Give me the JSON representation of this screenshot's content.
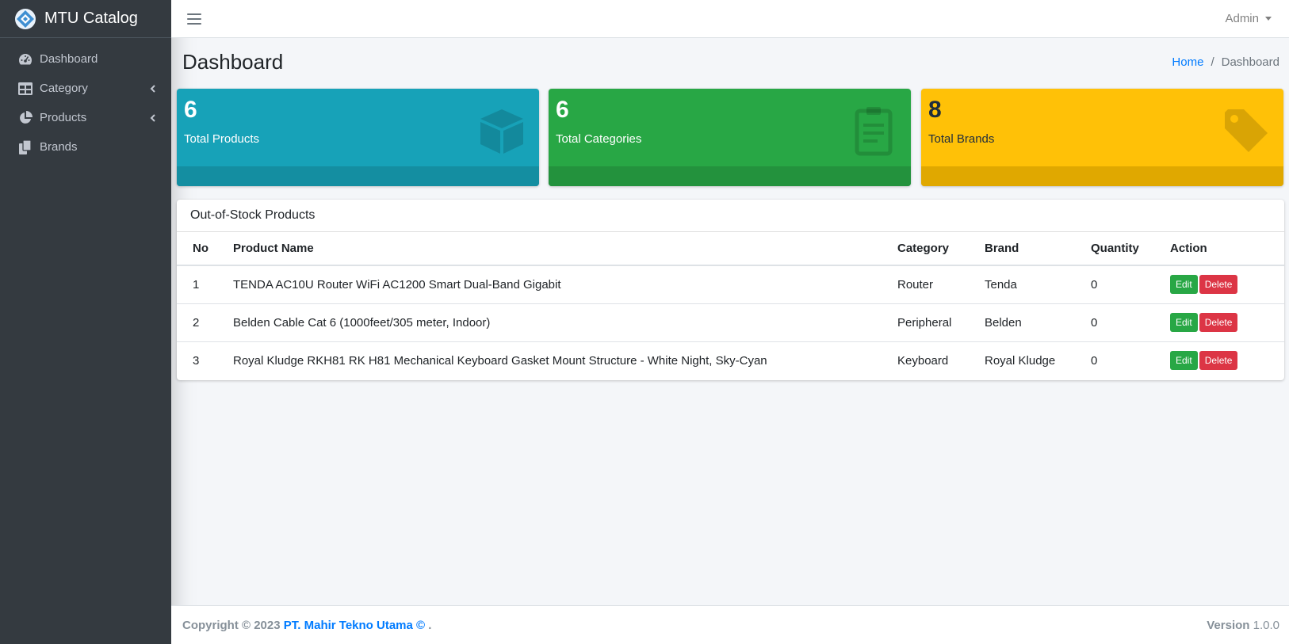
{
  "app": {
    "title": "MTU Catalog",
    "logo_icon": "diamond-logo-icon"
  },
  "sidebar": {
    "items": [
      {
        "label": "Dashboard",
        "icon": "tachometer-icon"
      },
      {
        "label": "Category",
        "icon": "table-icon",
        "has_submenu": true
      },
      {
        "label": "Products",
        "icon": "pie-chart-icon",
        "has_submenu": true
      },
      {
        "label": "Brands",
        "icon": "copy-icon"
      }
    ]
  },
  "topbar": {
    "user_label": "Admin"
  },
  "header": {
    "title": "Dashboard",
    "breadcrumb": {
      "home": "Home",
      "separator": "/",
      "active": "Dashboard"
    }
  },
  "stats": [
    {
      "count": "6",
      "label": "Total Products",
      "icon": "cube-icon",
      "color": "#17a2b8"
    },
    {
      "count": "6",
      "label": "Total Categories",
      "icon": "clipboard-icon",
      "color": "#28a745"
    },
    {
      "count": "8",
      "label": "Total Brands",
      "icon": "tag-icon",
      "color": "#ffc107"
    }
  ],
  "table": {
    "title": "Out-of-Stock Products",
    "columns": [
      "No",
      "Product Name",
      "Category",
      "Brand",
      "Quantity",
      "Action"
    ],
    "rows": [
      {
        "no": "1",
        "name": "TENDA AC10U Router WiFi AC1200 Smart Dual-Band Gigabit",
        "category": "Router",
        "brand": "Tenda",
        "quantity": "0"
      },
      {
        "no": "2",
        "name": "Belden Cable Cat 6 (1000feet/305 meter, Indoor)",
        "category": "Peripheral",
        "brand": "Belden",
        "quantity": "0"
      },
      {
        "no": "3",
        "name": "Royal Kludge RKH81 RK H81 Mechanical Keyboard Gasket Mount Structure - White Night, Sky-Cyan",
        "category": "Keyboard",
        "brand": "Royal Kludge",
        "quantity": "0"
      }
    ],
    "edit_label": "Edit",
    "delete_label": "Delete"
  },
  "footer": {
    "copyright": "Copyright © 2023",
    "company": "PT. Mahir Tekno Utama ©",
    "suffix": ".",
    "version_label": "Version",
    "version": "1.0.0"
  },
  "colors": {
    "sidebar_bg": "#343a40",
    "info": "#17a2b8",
    "success": "#28a745",
    "warning": "#ffc107",
    "danger": "#dc3545",
    "link": "#007bff"
  }
}
